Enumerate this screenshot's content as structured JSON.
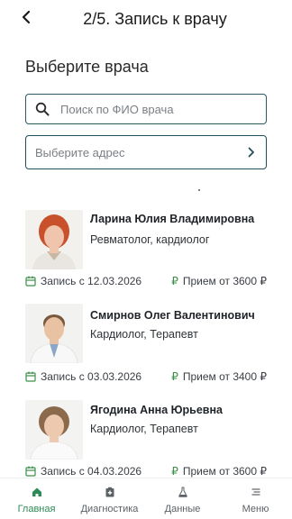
{
  "header": {
    "title": "2/5. Запись к врачу"
  },
  "section": {
    "title": "Выберите врача"
  },
  "search": {
    "placeholder": "Поиск по ФИО врача"
  },
  "address": {
    "placeholder": "Выберите адрес"
  },
  "doctors": [
    {
      "name": "Ларина Юлия Владимировна",
      "specialty": "Ревматолог, кардиолог",
      "slot": "Запись с 12.03.2026",
      "price_prefix": "₽",
      "price": "Прием от 3600 ₽"
    },
    {
      "name": "Смирнов Олег Валентинович",
      "specialty": "Кардиолог, Терапевт",
      "slot": "Запись с 03.03.2026",
      "price_prefix": "₽",
      "price": "Прием от 3400 ₽"
    },
    {
      "name": "Ягодина Анна Юрьевна",
      "specialty": "Кардиолог, Терапевт",
      "slot": "Запись с 04.03.2026",
      "price_prefix": "₽",
      "price": "Прием от 3600 ₽"
    }
  ],
  "nav": [
    {
      "label": "Главная",
      "icon": "home-icon",
      "active": true
    },
    {
      "label": "Диагностика",
      "icon": "diagnostics-icon",
      "active": false
    },
    {
      "label": "Данные",
      "icon": "flask-icon",
      "active": false
    },
    {
      "label": "Меню",
      "icon": "menu-icon",
      "active": false
    }
  ],
  "colors": {
    "accent": "#2e8b57",
    "border": "#1f4f5c",
    "price_icon": "#3d8f4a"
  }
}
